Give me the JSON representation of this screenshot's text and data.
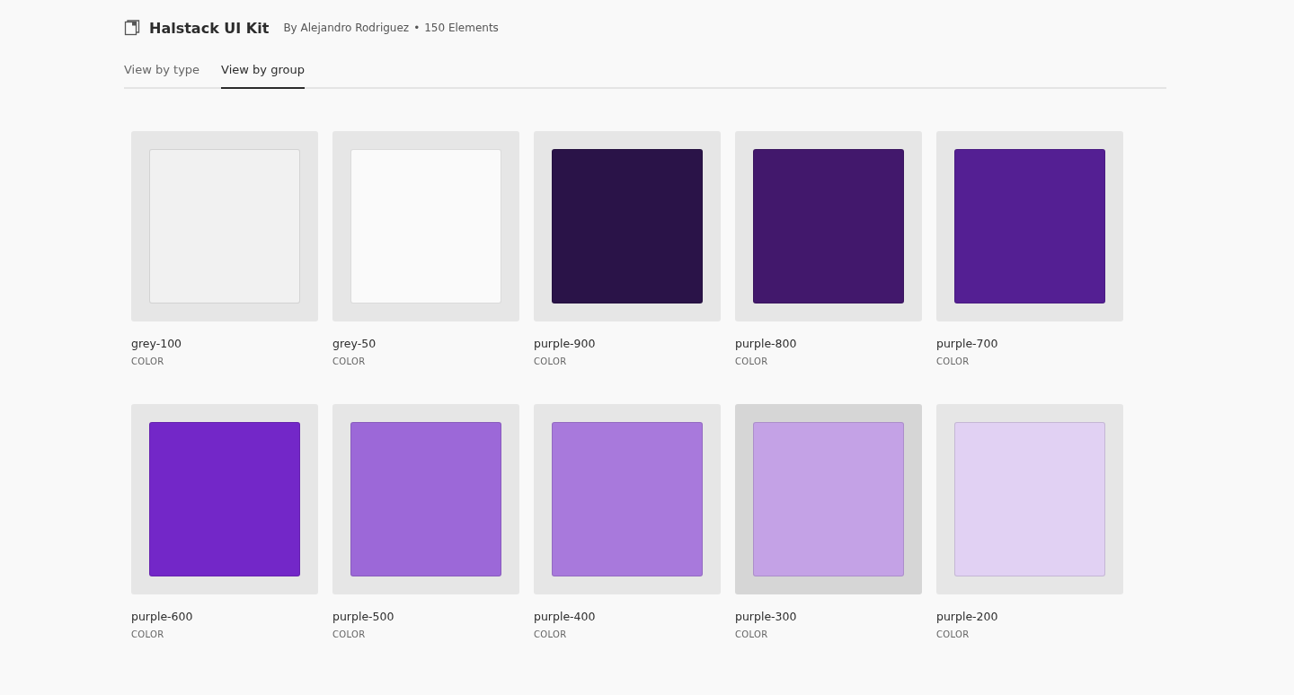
{
  "header": {
    "title": "Halstack UI Kit",
    "author": "By Alejandro Rodriguez",
    "separator": "•",
    "count": "150 Elements"
  },
  "tabs": [
    {
      "label": "View by type",
      "selected": false
    },
    {
      "label": "View by group",
      "selected": true
    }
  ],
  "swatches": [
    {
      "name": "grey-100",
      "type": "COLOR",
      "color": "#f1f1f1",
      "hovered": false
    },
    {
      "name": "grey-50",
      "type": "COLOR",
      "color": "#fafafa",
      "hovered": false
    },
    {
      "name": "purple-900",
      "type": "COLOR",
      "color": "#2a1348",
      "hovered": false
    },
    {
      "name": "purple-800",
      "type": "COLOR",
      "color": "#42186c",
      "hovered": false
    },
    {
      "name": "purple-700",
      "type": "COLOR",
      "color": "#541f93",
      "hovered": false
    },
    {
      "name": "purple-600",
      "type": "COLOR",
      "color": "#7327c8",
      "hovered": false
    },
    {
      "name": "purple-500",
      "type": "COLOR",
      "color": "#9c68d8",
      "hovered": false
    },
    {
      "name": "purple-400",
      "type": "COLOR",
      "color": "#a879dc",
      "hovered": false
    },
    {
      "name": "purple-300",
      "type": "COLOR",
      "color": "#c4a2e6",
      "hovered": true
    },
    {
      "name": "purple-200",
      "type": "COLOR",
      "color": "#e1d1f3",
      "hovered": false
    }
  ]
}
